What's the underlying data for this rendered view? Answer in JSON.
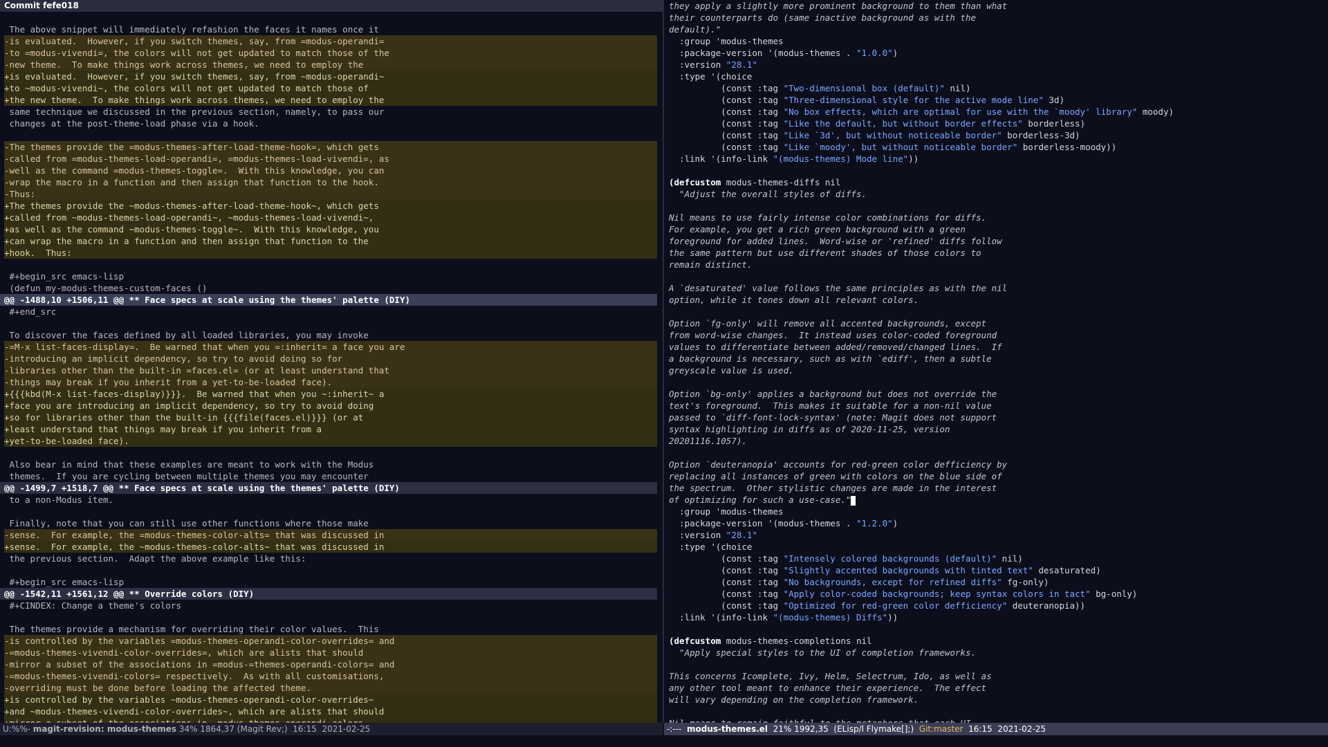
{
  "left": {
    "header": "Commit fefe018",
    "lines": [
      {
        "t": "ctx",
        "x": ""
      },
      {
        "t": "ctx",
        "x": " The above snippet will immediately refashion the faces it names once it"
      },
      {
        "t": "del",
        "x": "-is evaluated.  However, if you switch themes, say, from =modus-operandi="
      },
      {
        "t": "del",
        "x": "-to =modus-vivendi=, the colors will not get updated to match those of the"
      },
      {
        "t": "del",
        "x": "-new theme.  To make things work across themes, we need to employ the"
      },
      {
        "t": "add",
        "x": "+is evaluated.  However, if you switch themes, say, from ~modus-operandi~"
      },
      {
        "t": "add",
        "x": "+to ~modus-vivendi~, the colors will not get updated to match those of"
      },
      {
        "t": "add",
        "x": "+the new theme.  To make things work across themes, we need to employ the"
      },
      {
        "t": "ctx",
        "x": " same technique we discussed in the previous section, namely, to pass our"
      },
      {
        "t": "ctx",
        "x": " changes at the post-theme-load phase via a hook."
      },
      {
        "t": "ctx",
        "x": ""
      },
      {
        "t": "del",
        "x": "-The themes provide the =modus-themes-after-load-theme-hook=, which gets"
      },
      {
        "t": "del",
        "x": "-called from =modus-themes-load-operandi=, =modus-themes-load-vivendi=, as"
      },
      {
        "t": "del",
        "x": "-well as the command =modus-themes-toggle=.  With this knowledge, you can"
      },
      {
        "t": "del",
        "x": "-wrap the macro in a function and then assign that function to the hook."
      },
      {
        "t": "del",
        "x": "-Thus:"
      },
      {
        "t": "add",
        "x": "+The themes provide the ~modus-themes-after-load-theme-hook~, which gets"
      },
      {
        "t": "add",
        "x": "+called from ~modus-themes-load-operandi~, ~modus-themes-load-vivendi~,"
      },
      {
        "t": "add",
        "x": "+as well as the command ~modus-themes-toggle~.  With this knowledge, you"
      },
      {
        "t": "add",
        "x": "+can wrap the macro in a function and then assign that function to the"
      },
      {
        "t": "add",
        "x": "+hook.  Thus:"
      },
      {
        "t": "ctx",
        "x": ""
      },
      {
        "t": "ctx",
        "x": " #+begin_src emacs-lisp"
      },
      {
        "t": "ctx",
        "x": " (defun my-modus-themes-custom-faces ()"
      },
      {
        "t": "hunk",
        "x": "@@ -1488,10 +1506,11 @@ ** Face specs at scale using the themes' palette (DIY)"
      },
      {
        "t": "ctx",
        "x": " #+end_src"
      },
      {
        "t": "ctx",
        "x": ""
      },
      {
        "t": "ctx",
        "x": " To discover the faces defined by all loaded libraries, you may invoke"
      },
      {
        "t": "del",
        "x": "-=M-x list-faces-display=.  Be warned that when you =:inherit= a face you are"
      },
      {
        "t": "del",
        "x": "-introducing an implicit dependency, so try to avoid doing so for"
      },
      {
        "t": "del",
        "x": "-libraries other than the built-in =faces.el= (or at least understand that"
      },
      {
        "t": "del",
        "x": "-things may break if you inherit from a yet-to-be-loaded face)."
      },
      {
        "t": "add",
        "x": "+{{{kbd(M-x list-faces-display)}}}.  Be warned that when you ~:inherit~ a"
      },
      {
        "t": "add",
        "x": "+face you are introducing an implicit dependency, so try to avoid doing"
      },
      {
        "t": "add",
        "x": "+so for libraries other than the built-in {{{file(faces.el)}}} (or at"
      },
      {
        "t": "add",
        "x": "+least understand that things may break if you inherit from a"
      },
      {
        "t": "add",
        "x": "+yet-to-be-loaded face)."
      },
      {
        "t": "ctx",
        "x": ""
      },
      {
        "t": "ctx",
        "x": " Also bear in mind that these examples are meant to work with the Modus"
      },
      {
        "t": "ctx",
        "x": " themes.  If you are cycling between multiple themes you may encounter"
      },
      {
        "t": "hunkdim",
        "x": "@@ -1499,7 +1518,7 @@ ** Face specs at scale using the themes' palette (DIY)"
      },
      {
        "t": "ctx",
        "x": " to a non-Modus item."
      },
      {
        "t": "ctx",
        "x": ""
      },
      {
        "t": "ctx",
        "x": " Finally, note that you can still use other functions where those make"
      },
      {
        "t": "del",
        "x": "-sense.  For example, the =modus-themes-color-alts= that was discussed in"
      },
      {
        "t": "add",
        "x": "+sense.  For example, the ~modus-themes-color-alts~ that was discussed in"
      },
      {
        "t": "ctx",
        "x": " the previous section.  Adapt the above example like this:"
      },
      {
        "t": "ctx",
        "x": ""
      },
      {
        "t": "ctx",
        "x": " #+begin_src emacs-lisp"
      },
      {
        "t": "hunkdim",
        "x": "@@ -1542,11 +1561,12 @@ ** Override colors (DIY)"
      },
      {
        "t": "ctx",
        "x": " #+CINDEX: Change a theme's colors"
      },
      {
        "t": "ctx",
        "x": ""
      },
      {
        "t": "ctx",
        "x": " The themes provide a mechanism for overriding their color values.  This"
      },
      {
        "t": "del",
        "x": "-is controlled by the variables =modus-themes-operandi-color-overrides= and"
      },
      {
        "t": "del",
        "x": "-=modus-themes-vivendi-color-overrides=, which are alists that should"
      },
      {
        "t": "del",
        "x": "-mirror a subset of the associations in =modus-=themes-operandi-colors= and"
      },
      {
        "t": "del",
        "x": "-=modus-themes-vivendi-colors= respectively.  As with all customisations,"
      },
      {
        "t": "del",
        "x": "-overriding must be done before loading the affected theme."
      },
      {
        "t": "add",
        "x": "+is controlled by the variables ~modus-themes-operandi-color-overrides~"
      },
      {
        "t": "add",
        "x": "+and ~modus-themes-vivendi-color-overrides~, which are alists that should"
      },
      {
        "t": "add",
        "x": "+mirror a subset of the associations in ~modus-themes-operandi-colors~"
      }
    ]
  },
  "right": {
    "lines": [
      {
        "t": "doc",
        "x": "they apply a slightly more prominent background to them than what"
      },
      {
        "t": "doc",
        "x": "their counterparts do (same inactive background as with the"
      },
      {
        "t": "doc",
        "x": "default).\""
      },
      {
        "t": "kw",
        "x": "  :group 'modus-themes"
      },
      {
        "t": "kwstr",
        "x": "  :package-version '(modus-themes . ",
        "s": "\"1.0.0\"",
        "e": ")"
      },
      {
        "t": "kwstr",
        "x": "  :version ",
        "s": "\"28.1\"",
        "e": ""
      },
      {
        "t": "kw",
        "x": "  :type '(choice"
      },
      {
        "t": "kwstr",
        "x": "          (const :tag ",
        "s": "\"Two-dimensional box (default)\"",
        "e": " nil)"
      },
      {
        "t": "kwstr",
        "x": "          (const :tag ",
        "s": "\"Three-dimensional style for the active mode line\"",
        "e": " 3d)"
      },
      {
        "t": "kwstr",
        "x": "          (const :tag ",
        "s": "\"No box effects, which are optimal for use with the `moody' library\"",
        "e": " moody)"
      },
      {
        "t": "kwstr",
        "x": "          (const :tag ",
        "s": "\"Like the default, but without border effects\"",
        "e": " borderless)"
      },
      {
        "t": "kwstr",
        "x": "          (const :tag ",
        "s": "\"Like `3d', but without noticeable border\"",
        "e": " borderless-3d)"
      },
      {
        "t": "kwstr",
        "x": "          (const :tag ",
        "s": "\"Like `moody', but without noticeable border\"",
        "e": " borderless-moody))"
      },
      {
        "t": "kwstr",
        "x": "  :link '(info-link ",
        "s": "\"(modus-themes) Mode line\"",
        "e": "))"
      },
      {
        "t": "blank",
        "x": ""
      },
      {
        "t": "def",
        "x": "(defcustom ",
        "s": "modus-themes-diffs",
        "e": " nil"
      },
      {
        "t": "doc",
        "x": "  \"Adjust the overall styles of diffs."
      },
      {
        "t": "blank",
        "x": ""
      },
      {
        "t": "doc",
        "x": "Nil means to use fairly intense color combinations for diffs."
      },
      {
        "t": "doc",
        "x": "For example, you get a rich green background with a green"
      },
      {
        "t": "doc",
        "x": "foreground for added lines.  Word-wise or 'refined' diffs follow"
      },
      {
        "t": "doc",
        "x": "the same pattern but use different shades of those colors to"
      },
      {
        "t": "doc",
        "x": "remain distinct."
      },
      {
        "t": "blank",
        "x": ""
      },
      {
        "t": "doc",
        "x": "A `desaturated' value follows the same principles as with the nil"
      },
      {
        "t": "doc",
        "x": "option, while it tones down all relevant colors."
      },
      {
        "t": "blank",
        "x": ""
      },
      {
        "t": "doc",
        "x": "Option `fg-only' will remove all accented backgrounds, except"
      },
      {
        "t": "doc",
        "x": "from word-wise changes.  It instead uses color-coded foreground"
      },
      {
        "t": "doc",
        "x": "values to differentiate between added/removed/changed lines.  If"
      },
      {
        "t": "doc",
        "x": "a background is necessary, such as with `ediff', then a subtle"
      },
      {
        "t": "doc",
        "x": "greyscale value is used."
      },
      {
        "t": "blank",
        "x": ""
      },
      {
        "t": "doc",
        "x": "Option `bg-only' applies a background but does not override the"
      },
      {
        "t": "doc",
        "x": "text's foreground.  This makes it suitable for a non-nil value"
      },
      {
        "t": "doc",
        "x": "passed to `diff-font-lock-syntax' (note: Magit does not support"
      },
      {
        "t": "doc",
        "x": "syntax highlighting in diffs as of 2020-11-25, version"
      },
      {
        "t": "doc",
        "x": "20201116.1057)."
      },
      {
        "t": "blank",
        "x": ""
      },
      {
        "t": "doc",
        "x": "Option `deuteranopia' accounts for red-green color defficiency by"
      },
      {
        "t": "doc",
        "x": "replacing all instances of green with colors on the blue side of"
      },
      {
        "t": "doc",
        "x": "the spectrum.  Other stylistic changes are made in the interest"
      },
      {
        "t": "doccursor",
        "x": "of optimizing for such a use-case.\""
      },
      {
        "t": "kw",
        "x": "  :group 'modus-themes"
      },
      {
        "t": "kwstr",
        "x": "  :package-version '(modus-themes . ",
        "s": "\"1.2.0\"",
        "e": ")"
      },
      {
        "t": "kwstr",
        "x": "  :version ",
        "s": "\"28.1\"",
        "e": ""
      },
      {
        "t": "kw",
        "x": "  :type '(choice"
      },
      {
        "t": "kwstr",
        "x": "          (const :tag ",
        "s": "\"Intensely colored backgrounds (default)\"",
        "e": " nil)"
      },
      {
        "t": "kwstr",
        "x": "          (const :tag ",
        "s": "\"Slightly accented backgrounds with tinted text\"",
        "e": " desaturated)"
      },
      {
        "t": "kwstr",
        "x": "          (const :tag ",
        "s": "\"No backgrounds, except for refined diffs\"",
        "e": " fg-only)"
      },
      {
        "t": "kwstr",
        "x": "          (const :tag ",
        "s": "\"Apply color-coded backgrounds; keep syntax colors in tact\"",
        "e": " bg-only)"
      },
      {
        "t": "kwstr",
        "x": "          (const :tag ",
        "s": "\"Optimized for red-green color defficiency\"",
        "e": " deuteranopia))"
      },
      {
        "t": "kwstr",
        "x": "  :link '(info-link ",
        "s": "\"(modus-themes) Diffs\"",
        "e": "))"
      },
      {
        "t": "blank",
        "x": ""
      },
      {
        "t": "def",
        "x": "(defcustom ",
        "s": "modus-themes-completions",
        "e": " nil"
      },
      {
        "t": "doc",
        "x": "  \"Apply special styles to the UI of completion frameworks."
      },
      {
        "t": "blank",
        "x": ""
      },
      {
        "t": "doc",
        "x": "This concerns Icomplete, Ivy, Helm, Selectrum, Ido, as well as"
      },
      {
        "t": "doc",
        "x": "any other tool meant to enhance their experience.  The effect"
      },
      {
        "t": "doc",
        "x": "will vary depending on the completion framework."
      },
      {
        "t": "blank",
        "x": ""
      },
      {
        "t": "doc",
        "x": "Nil means to remain faithful to the metaphors that each UI"
      }
    ]
  },
  "status_left": {
    "flags": "U:%%- ",
    "buffer": "magit-revision: modus-themes",
    "position": " 34% 1864,37",
    "mode": " (Magit Rev;)",
    "time": "  16:15  2021-02-25"
  },
  "status_right": {
    "flags": "-:---  ",
    "buffer": "modus-themes.el",
    "position": "  21% 1992,35",
    "mode": "  (ELisp/l Flymake[];)",
    "git": "  Git:master",
    "time": "  16:15  2021-02-25"
  },
  "colors": {
    "background": "#0d0e1c",
    "diff_removed_bg": "#3a3217",
    "diff_added_bg": "#332f14",
    "hunk_header_bg": "#3a4157",
    "string": "#79a8ff",
    "modeline_active": "#3b3d55"
  }
}
